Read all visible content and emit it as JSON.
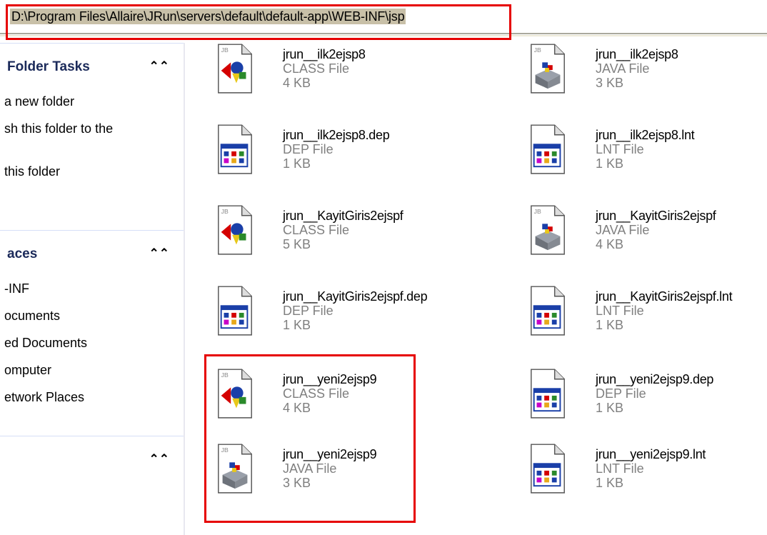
{
  "address": {
    "path": "D:\\Program Files\\Allaire\\JRun\\servers\\default\\default-app\\WEB-INF\\jsp"
  },
  "sidebar": {
    "folder_tasks": {
      "title": "Folder Tasks",
      "items": [
        "a new folder",
        "sh this folder to the",
        "this folder"
      ]
    },
    "other_places": {
      "title": "aces",
      "items": [
        "-INF",
        "ocuments",
        "ed Documents",
        "omputer",
        "etwork Places"
      ]
    },
    "details": {
      "title": ""
    }
  },
  "files": [
    {
      "name": "jrun__ilk2ejsp8",
      "type": "CLASS File",
      "size": "4 KB",
      "icon": "class-file-icon"
    },
    {
      "name": "jrun__ilk2ejsp8",
      "type": "JAVA File",
      "size": "3 KB",
      "icon": "java-file-icon"
    },
    {
      "name": "jrun__ilk2ejsp8.dep",
      "type": "DEP File",
      "size": "1 KB",
      "icon": "dep-file-icon"
    },
    {
      "name": "jrun__ilk2ejsp8.lnt",
      "type": "LNT File",
      "size": "1 KB",
      "icon": "lnt-file-icon"
    },
    {
      "name": "jrun__KayitGiris2ejspf",
      "type": "CLASS File",
      "size": "5 KB",
      "icon": "class-file-icon"
    },
    {
      "name": "jrun__KayitGiris2ejspf",
      "type": "JAVA File",
      "size": "4 KB",
      "icon": "java-file-icon"
    },
    {
      "name": "jrun__KayitGiris2ejspf.dep",
      "type": "DEP File",
      "size": "1 KB",
      "icon": "dep-file-icon"
    },
    {
      "name": "jrun__KayitGiris2ejspf.lnt",
      "type": "LNT File",
      "size": "1 KB",
      "icon": "lnt-file-icon"
    },
    {
      "name": "jrun__yeni2ejsp9",
      "type": "CLASS File",
      "size": "4 KB",
      "icon": "class-file-icon"
    },
    {
      "name": "jrun__yeni2ejsp9.dep",
      "type": "DEP File",
      "size": "1 KB",
      "icon": "dep-file-icon"
    },
    {
      "name": "jrun__yeni2ejsp9",
      "type": "JAVA File",
      "size": "3 KB",
      "icon": "java-file-icon"
    },
    {
      "name": "jrun__yeni2ejsp9.lnt",
      "type": "LNT File",
      "size": "1 KB",
      "icon": "lnt-file-icon"
    }
  ],
  "colors": {
    "highlight": "#e60000",
    "panel_title": "#1b2a5a",
    "secondary_text": "#7f7f7f"
  }
}
